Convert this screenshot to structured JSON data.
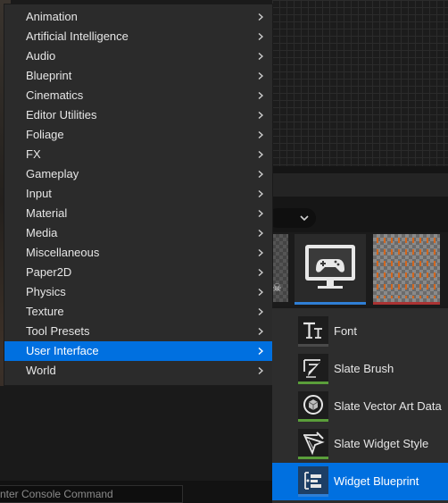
{
  "menu": {
    "items": [
      {
        "label": "Animation"
      },
      {
        "label": "Artificial Intelligence"
      },
      {
        "label": "Audio"
      },
      {
        "label": "Blueprint"
      },
      {
        "label": "Cinematics"
      },
      {
        "label": "Editor Utilities"
      },
      {
        "label": "Foliage"
      },
      {
        "label": "FX"
      },
      {
        "label": "Gameplay"
      },
      {
        "label": "Input"
      },
      {
        "label": "Material"
      },
      {
        "label": "Media"
      },
      {
        "label": "Miscellaneous"
      },
      {
        "label": "Paper2D"
      },
      {
        "label": "Physics"
      },
      {
        "label": "Texture"
      },
      {
        "label": "Tool Presets"
      },
      {
        "label": "User Interface",
        "selected": true
      },
      {
        "label": "World"
      }
    ],
    "arrow_icon": "chevron-right-icon",
    "highlight_color": "#0070E0"
  },
  "submenu": {
    "parent": "User Interface",
    "items": [
      {
        "label": "Font",
        "icon": "font-tt-icon",
        "accent": "#4a4a4a"
      },
      {
        "label": "Slate Brush",
        "icon": "slate-brush-icon",
        "accent": "#5a9e3a"
      },
      {
        "label": "Slate Vector Art Data",
        "icon": "slate-vector-art-icon",
        "accent": "#5a9e3a"
      },
      {
        "label": "Slate Widget Style",
        "icon": "slate-widget-style-icon",
        "accent": "#5a9e3a"
      },
      {
        "label": "Widget Blueprint",
        "icon": "widget-blueprint-icon",
        "accent": "#2f7fd6",
        "selected": true
      }
    ]
  },
  "background": {
    "console_placeholder": "Enter Console Command",
    "filter_dropdown_icon": "chevron-down-icon",
    "thumbnail_icons": [
      "gamepad-monitor-icon",
      "skull-icon"
    ]
  }
}
